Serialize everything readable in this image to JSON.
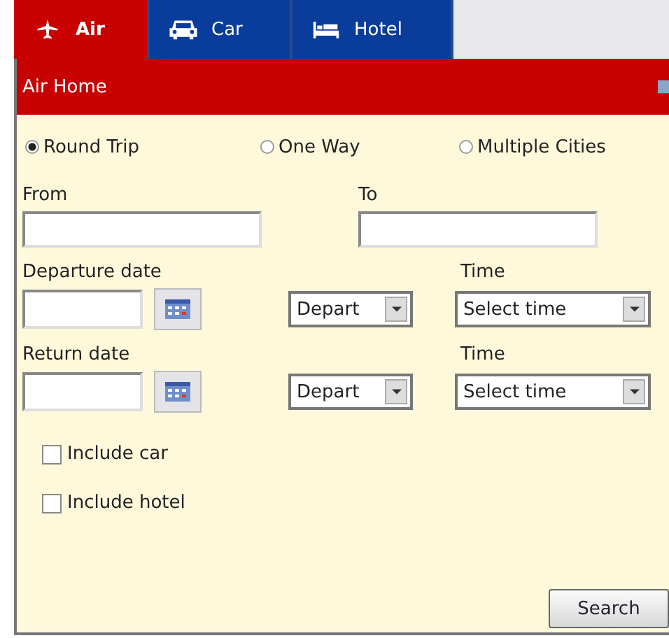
{
  "tabs": [
    {
      "label": "Air",
      "kind": "air",
      "selected": true
    },
    {
      "label": "Car",
      "kind": "car",
      "selected": false
    },
    {
      "label": "Hotel",
      "kind": "hotel",
      "selected": false
    }
  ],
  "header": {
    "title": "Air Home"
  },
  "trip_types": [
    {
      "label": "Round Trip",
      "selected": true
    },
    {
      "label": "One Way",
      "selected": false
    },
    {
      "label": "Multiple Cities",
      "selected": false
    }
  ],
  "from": {
    "label": "From"
  },
  "to": {
    "label": "To"
  },
  "dates": [
    {
      "label": "Departure date",
      "mode": "Depart",
      "time_label": "Time",
      "time": "Select time"
    },
    {
      "label": "Return date",
      "mode": "Depart",
      "time_label": "Time",
      "time": "Select time"
    }
  ],
  "options": [
    {
      "label": "Include car",
      "checked": false
    },
    {
      "label": "Include hotel",
      "checked": false
    }
  ],
  "search_button": "Search"
}
